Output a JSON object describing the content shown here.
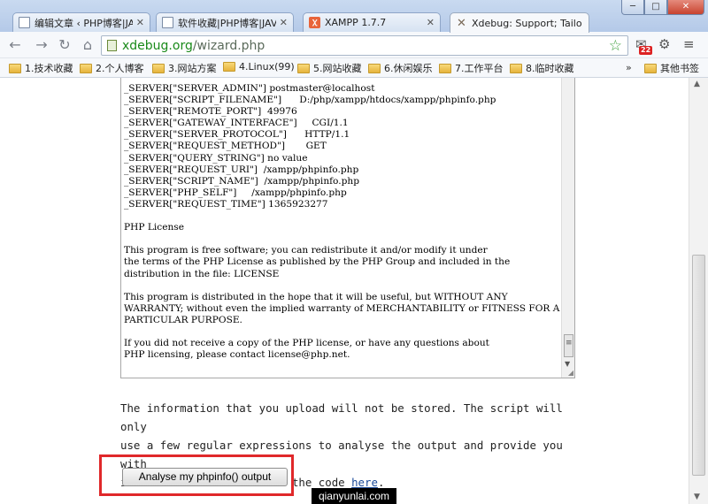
{
  "tabs": [
    {
      "title": "编辑文章 ‹ PHP博客|JAVA",
      "icon": "document-icon"
    },
    {
      "title": "软件收藏|PHP博客|JAVA",
      "icon": "document-icon"
    },
    {
      "title": "XAMPP 1.7.7",
      "icon": "xampp-icon"
    },
    {
      "title": "Xdebug: Support; Tailo",
      "icon": "xdebug-icon"
    }
  ],
  "window_controls": {
    "minimize": "─",
    "maximize": "□",
    "close": "✕"
  },
  "toolbar": {
    "url_host": "xdebug.org",
    "url_path": "/wizard.php",
    "badge_count": "22"
  },
  "bookmarks": [
    "1.技术收藏",
    "2.个人博客",
    "3.网站方案",
    "4.Linux(99)",
    "5.网站收藏",
    "6.休闲娱乐",
    "7.工作平台",
    "8.临时收藏"
  ],
  "bookmarks_overflow": "»",
  "other_bookmarks": "其他书签",
  "phpinfo_text": "_SERVER[\"SERVER_ADMIN\"] postmaster@localhost\n_SERVER[\"SCRIPT_FILENAME\"]      D:/php/xampp/htdocs/xampp/phpinfo.php\n_SERVER[\"REMOTE_PORT\"]  49976\n_SERVER[\"GATEWAY_INTERFACE\"]     CGI/1.1\n_SERVER[\"SERVER_PROTOCOL\"]      HTTP/1.1\n_SERVER[\"REQUEST_METHOD\"]       GET\n_SERVER[\"QUERY_STRING\"] no value\n_SERVER[\"REQUEST_URI\"]  /xampp/phpinfo.php\n_SERVER[\"SCRIPT_NAME\"]  /xampp/phpinfo.php\n_SERVER[\"PHP_SELF\"]     /xampp/phpinfo.php\n_SERVER[\"REQUEST_TIME\"] 1365923277\n\nPHP License\n\nThis program is free software; you can redistribute it and/or modify it under\nthe terms of the PHP License as published by the PHP Group and included in the\ndistribution in the file: LICENSE\n\nThis program is distributed in the hope that it will be useful, but WITHOUT ANY\nWARRANTY; without even the implied warranty of MERCHANTABILITY or FITNESS FOR A\nPARTICULAR PURPOSE.\n\nIf you did not receive a copy of the PHP license, or have any questions about\nPHP licensing, please contact license@php.net.",
  "info": {
    "line1": "The information that you upload will not be stored. The script will only",
    "line2": "use a few regular expressions to analyse the output and provide you with",
    "line3_prefix": "instructions. You can see the code ",
    "link_text": "here",
    "line3_suffix": "."
  },
  "analyse_button": "Analyse my phpinfo() output",
  "watermark": "qianyunlai.com"
}
